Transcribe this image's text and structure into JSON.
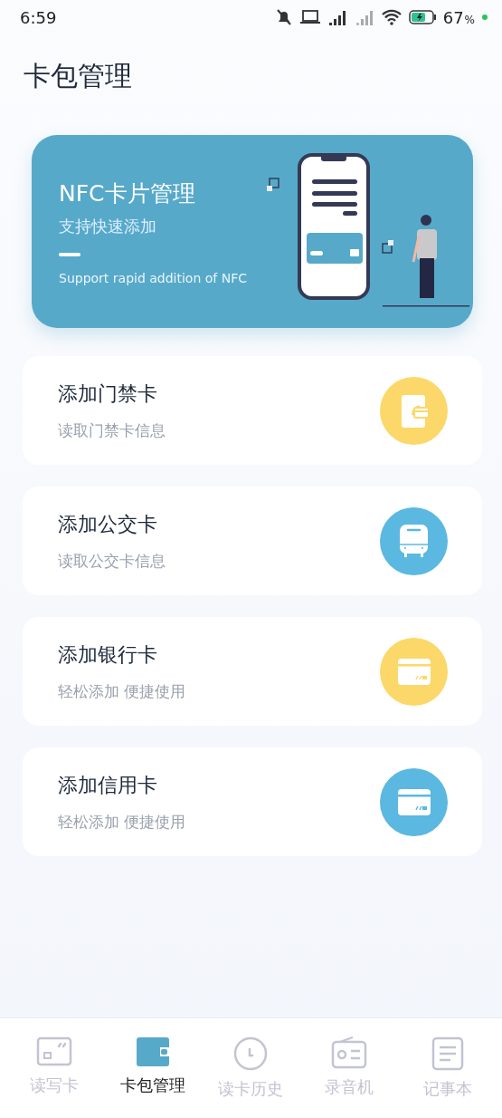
{
  "status_bar": {
    "time": "6:59",
    "battery_percent": "67",
    "percent_sign": "%"
  },
  "title": "卡包管理",
  "banner": {
    "title": "NFC卡片管理",
    "subtitle": "支持快速添加",
    "caption": "Support rapid addition of NFC"
  },
  "cards": [
    {
      "title": "添加门禁卡",
      "subtitle": "读取门禁卡信息",
      "kind": "door",
      "color": "#fcd86a"
    },
    {
      "title": "添加公交卡",
      "subtitle": "读取公交卡信息",
      "kind": "bus",
      "color": "#5bb8e0"
    },
    {
      "title": "添加银行卡",
      "subtitle": "轻松添加 便捷使用",
      "kind": "card",
      "color": "#fcd86a"
    },
    {
      "title": "添加信用卡",
      "subtitle": "轻松添加 便捷使用",
      "kind": "card",
      "color": "#5bb8e0"
    }
  ],
  "tabs": [
    {
      "label": "读写卡",
      "kind": "readwrite",
      "selected": false
    },
    {
      "label": "卡包管理",
      "kind": "wallet",
      "selected": true
    },
    {
      "label": "读卡历史",
      "kind": "clock",
      "selected": false
    },
    {
      "label": "录音机",
      "kind": "radio",
      "selected": false
    },
    {
      "label": "记事本",
      "kind": "note",
      "selected": false
    }
  ]
}
